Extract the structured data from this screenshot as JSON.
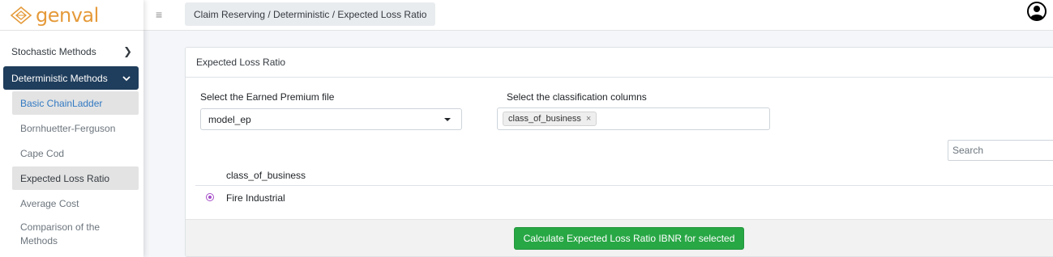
{
  "brand": {
    "name": "genval",
    "logo_icon": "diamond-logo-icon",
    "accent_color": "#e59a3a"
  },
  "sidebar": {
    "items": [
      {
        "label": "Stochastic Methods",
        "icon": "chevron-right-icon"
      },
      {
        "label": "Deterministic Methods",
        "icon": "chevron-down-icon"
      }
    ],
    "subitems": [
      {
        "label": "Basic ChainLadder"
      },
      {
        "label": "Bornhuetter-Ferguson"
      },
      {
        "label": "Cape Cod"
      },
      {
        "label": "Expected Loss Ratio"
      },
      {
        "label": "Average Cost"
      },
      {
        "label": "Comparison of the Methods"
      }
    ],
    "active_color": "#1f3d5c"
  },
  "topbar": {
    "menu_icon": "hamburger-icon",
    "breadcrumb": "Claim Reserving / Deterministic / Expected Loss Ratio",
    "user_icon": "user-avatar-icon"
  },
  "card": {
    "title": "Expected Loss Ratio",
    "premium_label": "Select the Earned Premium file",
    "premium_value": "model_ep",
    "class_label": "Select the classification columns",
    "class_tag": "class_of_business",
    "tag_remove": "×",
    "search_placeholder": "Search",
    "table": {
      "header": "class_of_business",
      "rows": [
        {
          "label": "Fire Industrial",
          "selected": true
        }
      ]
    },
    "button_label": "Calculate Expected Loss Ratio IBNR for selected",
    "button_color": "#28a745",
    "radio_color": "#a64ec9"
  }
}
